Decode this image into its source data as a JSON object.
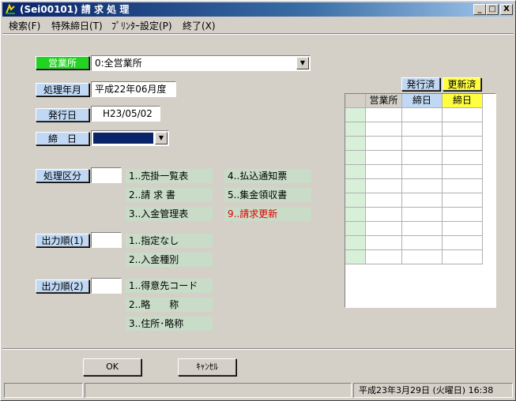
{
  "window": {
    "title": "(Sei00101) 請 求 処 理",
    "btn_min": "_",
    "btn_max": "□",
    "btn_close": "X"
  },
  "menu": [
    "検索(F)",
    "特殊締日(T)",
    "ﾌﾟﾘﾝﾀｰ設定(P)",
    "終了(X)"
  ],
  "form": {
    "office_label": "営業所",
    "office_value": "0:全営業所",
    "month_label": "処理年月",
    "month_value": "平成22年06月度",
    "issue_label": "発行日",
    "issue_value": "H23/05/02",
    "close_label": "締　日",
    "close_value": "",
    "type_label": "処理区分",
    "type_options": [
      "1..売掛一覧表",
      "2..請 求 書",
      "3..入金管理表",
      "4..払込通知票",
      "5..集金領収書",
      "9..請求更新"
    ],
    "order1_label": "出力順(1)",
    "order1_options": [
      "1..指定なし",
      "2..入金種別"
    ],
    "order2_label": "出力順(2)",
    "order2_options": [
      "1..得意先コード",
      "2..略　　称",
      "3..住所･略称"
    ]
  },
  "grid": {
    "issued_label": "発行済",
    "updated_label": "更新済",
    "headers": [
      "営業所",
      "締日",
      "締日"
    ]
  },
  "buttons": {
    "ok": "OK",
    "cancel": "ｷｬﾝｾﾙ"
  },
  "status": {
    "datetime": "平成23年3月29日 (火曜日)  16:38"
  }
}
